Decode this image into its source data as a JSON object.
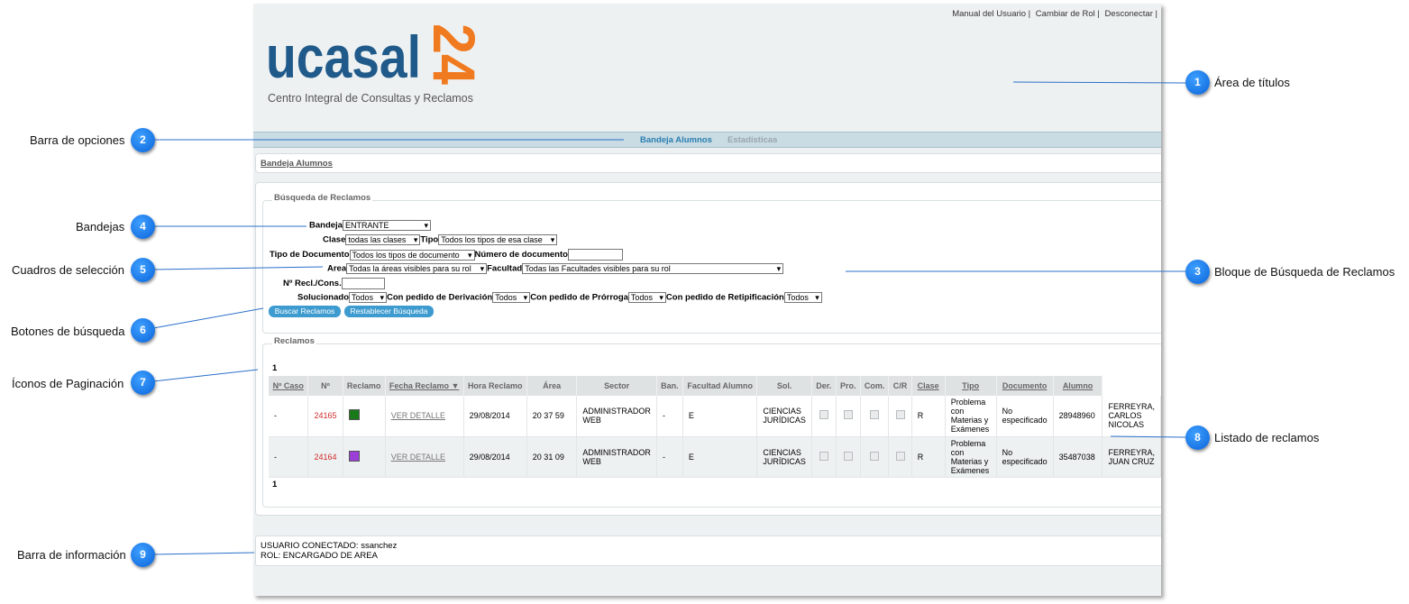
{
  "top_links": [
    "Manual del Usuario",
    "Cambiar de Rol",
    "Desconectar"
  ],
  "logo": {
    "text": "ucasal",
    "number": "24"
  },
  "subtitle": "Centro Integral de Consultas y Reclamos",
  "nav": {
    "active": "Bandeja Alumnos",
    "stats": "Estadísticas"
  },
  "breadcrumb": "Bandeja Alumnos",
  "search": {
    "legend": "Búsqueda de Reclamos",
    "bandeja_label": "Bandeja",
    "bandeja_value": "ENTRANTE",
    "clase_label": "Clase",
    "clase_value": "todas las clases",
    "tipo_label": "Tipo",
    "tipo_value": "Todos los tipos de esa clase",
    "tipo_doc_label": "Tipo de Documento",
    "tipo_doc_value": "Todos los tipos de documento",
    "num_doc_label": "Número de documento",
    "area_label": "Area",
    "area_value": "Todas la áreas visibles para su rol",
    "facultad_label": "Facultad",
    "facultad_value": "Todas las Facultades visibles para su rol",
    "nrecl_label": "Nº Recl./Cons.",
    "solucionado_label": "Solucionado",
    "solucionado_value": "Todos",
    "derivacion_label": "Con pedido de Derivación",
    "derivacion_value": "Todos",
    "prorroga_label": "Con pedido de Prórroga",
    "prorroga_value": "Todos",
    "retipificacion_label": "Con pedido de Retipificación",
    "retipificacion_value": "Todos",
    "buscar_btn": "Buscar Reclamos",
    "restablecer_btn": "Restablecer Búsqueda"
  },
  "reclamos": {
    "legend": "Reclamos",
    "page": "1",
    "columns": [
      "Nº Caso",
      "Nº",
      "Reclamo",
      "Fecha Reclamo ▼",
      "Hora Reclamo",
      "Área",
      "Sector",
      "Ban.",
      "Facultad Alumno",
      "Sol.",
      "Der.",
      "Pro.",
      "Com.",
      "C/R",
      "Clase",
      "Tipo",
      "Documento",
      "Alumno"
    ],
    "rows": [
      {
        "caso": "-",
        "num": "24165",
        "color": "#1a7a1a",
        "detalle": "VER DETALLE",
        "fecha": "29/08/2014",
        "hora": "20 37 59",
        "area": "ADMINISTRADOR WEB",
        "sector": "-",
        "ban": "E",
        "facultad": "CIENCIAS JURÍDICAS",
        "cr": "R",
        "clase": "Problema con Materias y Exámenes",
        "tipo": "No especificado",
        "documento": "28948960",
        "alumno": "FERREYRA, CARLOS NICOLAS"
      },
      {
        "caso": "-",
        "num": "24164",
        "color": "#9b3fd6",
        "detalle": "VER DETALLE",
        "fecha": "29/08/2014",
        "hora": "20 31 09",
        "area": "ADMINISTRADOR WEB",
        "sector": "-",
        "ban": "E",
        "facultad": "CIENCIAS JURÍDICAS",
        "cr": "R",
        "clase": "Problema con Materias y Exámenes",
        "tipo": "No especificado",
        "documento": "35487038",
        "alumno": "FERREYRA, JUAN CRUZ"
      }
    ]
  },
  "info": {
    "usuario": "USUARIO CONECTADO: ssanchez",
    "rol": "ROL: ENCARGADO DE AREA"
  },
  "callouts": [
    {
      "n": "1",
      "label": "Área de títulos"
    },
    {
      "n": "2",
      "label": "Barra de opciones"
    },
    {
      "n": "3",
      "label": "Bloque de Búsqueda de Reclamos"
    },
    {
      "n": "4",
      "label": "Bandejas"
    },
    {
      "n": "5",
      "label": "Cuadros de selección"
    },
    {
      "n": "6",
      "label": "Botones de búsqueda"
    },
    {
      "n": "7",
      "label": "Íconos de Paginación"
    },
    {
      "n": "8",
      "label": "Listado de reclamos"
    },
    {
      "n": "9",
      "label": "Barra de información"
    }
  ],
  "colors": {
    "accent": "#2a7fb2",
    "button": "#3d9bd0",
    "callout": "#0a63d9",
    "logo_blue": "#1f5a8a",
    "logo_orange": "#f07a1f"
  }
}
